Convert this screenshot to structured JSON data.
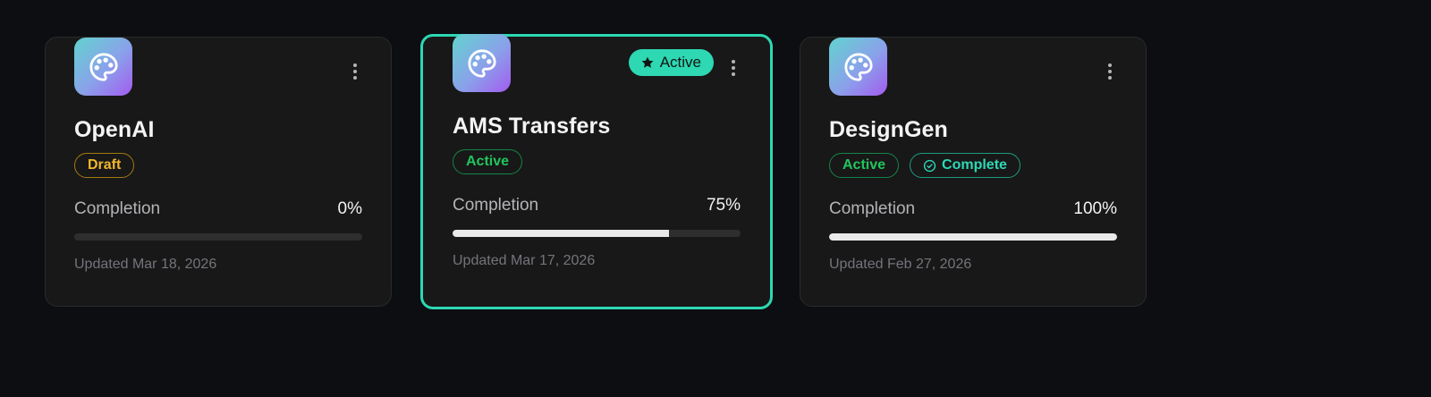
{
  "cards": [
    {
      "title": "OpenAI",
      "status_tag": "Draft",
      "completion_label": "Completion",
      "completion_value": "0%",
      "completion_fraction": 0,
      "updated": "Updated Mar 18, 2026"
    },
    {
      "title": "AMS Transfers",
      "pinned_badge": "Active",
      "status_tag": "Active",
      "completion_label": "Completion",
      "completion_value": "75%",
      "completion_fraction": 0.75,
      "updated": "Updated Mar 17, 2026"
    },
    {
      "title": "DesignGen",
      "status_tag": "Active",
      "complete_tag": "Complete",
      "completion_label": "Completion",
      "completion_value": "100%",
      "completion_fraction": 1,
      "updated": "Updated Feb 27, 2026"
    }
  ],
  "icons": {
    "project": "palette-icon",
    "menu": "more-vertical-icon",
    "pinned": "star-icon",
    "complete": "check-circle-icon"
  },
  "colors": {
    "background": "#0c0e12",
    "card": "#181818",
    "selected_border": "#2dd8b3",
    "draft": "#f0b72a",
    "active": "#22c55e",
    "complete": "#2dd8b3",
    "progress_fill": "#e9e9e9"
  }
}
